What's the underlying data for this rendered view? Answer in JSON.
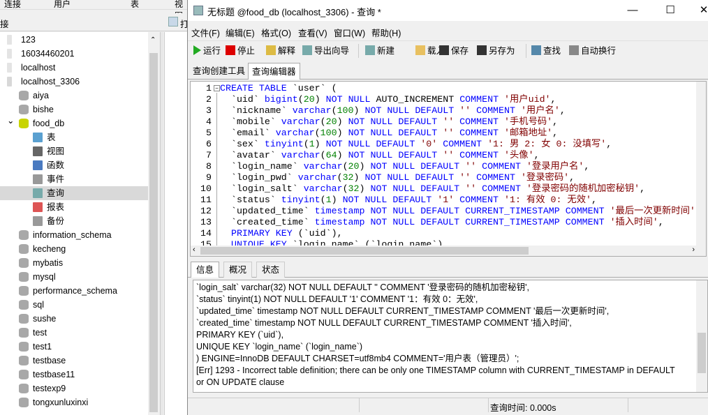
{
  "app_tabs": [
    "连接",
    "用户",
    "表",
    "视图"
  ],
  "connection_header": "接",
  "open_label": "打",
  "tree": [
    {
      "label": "123",
      "level": 0,
      "icon": "server-icon"
    },
    {
      "label": "16034460201",
      "level": 0,
      "icon": "server-icon"
    },
    {
      "label": "localhost",
      "level": 0,
      "icon": "server-icon"
    },
    {
      "label": "localhost_3306",
      "level": 0,
      "icon": "server-connected-icon"
    },
    {
      "label": "aiya",
      "level": 1,
      "icon": "database-icon"
    },
    {
      "label": "bishe",
      "level": 1,
      "icon": "database-icon"
    },
    {
      "label": "food_db",
      "level": 1,
      "icon": "database-open-icon",
      "expanded": true
    },
    {
      "label": "表",
      "level": 2,
      "icon": "table-icon"
    },
    {
      "label": "视图",
      "level": 2,
      "icon": "view-icon"
    },
    {
      "label": "函数",
      "level": 2,
      "icon": "function-icon"
    },
    {
      "label": "事件",
      "level": 2,
      "icon": "event-icon"
    },
    {
      "label": "查询",
      "level": 2,
      "icon": "query-icon",
      "selected": true
    },
    {
      "label": "报表",
      "level": 2,
      "icon": "report-icon"
    },
    {
      "label": "备份",
      "level": 2,
      "icon": "backup-icon"
    },
    {
      "label": "information_schema",
      "level": 1,
      "icon": "database-icon"
    },
    {
      "label": "kecheng",
      "level": 1,
      "icon": "database-icon"
    },
    {
      "label": "mybatis",
      "level": 1,
      "icon": "database-icon"
    },
    {
      "label": "mysql",
      "level": 1,
      "icon": "database-icon"
    },
    {
      "label": "performance_schema",
      "level": 1,
      "icon": "database-icon"
    },
    {
      "label": "sql",
      "level": 1,
      "icon": "database-icon"
    },
    {
      "label": "sushe",
      "level": 1,
      "icon": "database-icon"
    },
    {
      "label": "test",
      "level": 1,
      "icon": "database-icon"
    },
    {
      "label": "test1",
      "level": 1,
      "icon": "database-icon"
    },
    {
      "label": "testbase",
      "level": 1,
      "icon": "database-icon"
    },
    {
      "label": "testbase11",
      "level": 1,
      "icon": "database-icon"
    },
    {
      "label": "testexp9",
      "level": 1,
      "icon": "database-icon"
    },
    {
      "label": "tongxunluxinxi",
      "level": 1,
      "icon": "database-icon"
    }
  ],
  "window": {
    "title": "无标题 @food_db (localhost_3306) - 查询 *",
    "controls": {
      "minimize": "—",
      "maximize": "☐",
      "close": "✕"
    }
  },
  "menu": [
    "文件(F)",
    "编辑(E)",
    "格式(O)",
    "查看(V)",
    "窗口(W)",
    "帮助(H)"
  ],
  "toolbar": [
    {
      "label": "运行",
      "icon": "run-icon"
    },
    {
      "label": "停止",
      "icon": "stop-icon"
    },
    {
      "label": "解释",
      "icon": "explain-icon"
    },
    {
      "label": "导出向导",
      "icon": "export-wizard-icon"
    },
    {
      "label": "新建",
      "icon": "new-icon"
    },
    {
      "label": "载入",
      "icon": "load-icon"
    },
    {
      "label": "保存",
      "icon": "save-icon"
    },
    {
      "label": "另存为",
      "icon": "save-as-icon"
    },
    {
      "label": "查找",
      "icon": "find-icon"
    },
    {
      "label": "自动换行",
      "icon": "word-wrap-icon"
    }
  ],
  "query_tabs": [
    "查询创建工具",
    "查询编辑器"
  ],
  "active_query_tab": 1,
  "code_lines": [
    [
      [
        "CREATE TABLE ",
        "kw"
      ],
      [
        "`user` (",
        "id"
      ]
    ],
    [
      [
        "  `uid` ",
        "id"
      ],
      [
        "bigint",
        "kw"
      ],
      [
        "(",
        "id"
      ],
      [
        "20",
        "num"
      ],
      [
        ") ",
        "id"
      ],
      [
        "NOT NULL ",
        "kw"
      ],
      [
        "AUTO_INCREMENT ",
        "id"
      ],
      [
        "COMMENT ",
        "kw"
      ],
      [
        "'用户uid'",
        "str"
      ],
      [
        ",",
        "id"
      ]
    ],
    [
      [
        "  `nickname` ",
        "id"
      ],
      [
        "varchar",
        "kw"
      ],
      [
        "(",
        "id"
      ],
      [
        "100",
        "num"
      ],
      [
        ") ",
        "id"
      ],
      [
        "NOT NULL DEFAULT ",
        "kw"
      ],
      [
        "'' ",
        "str"
      ],
      [
        "COMMENT ",
        "kw"
      ],
      [
        "'用户名'",
        "str"
      ],
      [
        ",",
        "id"
      ]
    ],
    [
      [
        "  `mobile` ",
        "id"
      ],
      [
        "varchar",
        "kw"
      ],
      [
        "(",
        "id"
      ],
      [
        "20",
        "num"
      ],
      [
        ") ",
        "id"
      ],
      [
        "NOT NULL DEFAULT ",
        "kw"
      ],
      [
        "'' ",
        "str"
      ],
      [
        "COMMENT ",
        "kw"
      ],
      [
        "'手机号码'",
        "str"
      ],
      [
        ",",
        "id"
      ]
    ],
    [
      [
        "  `email` ",
        "id"
      ],
      [
        "varchar",
        "kw"
      ],
      [
        "(",
        "id"
      ],
      [
        "100",
        "num"
      ],
      [
        ") ",
        "id"
      ],
      [
        "NOT NULL DEFAULT ",
        "kw"
      ],
      [
        "'' ",
        "str"
      ],
      [
        "COMMENT ",
        "kw"
      ],
      [
        "'邮箱地址'",
        "str"
      ],
      [
        ",",
        "id"
      ]
    ],
    [
      [
        "  `sex` ",
        "id"
      ],
      [
        "tinyint",
        "kw"
      ],
      [
        "(",
        "id"
      ],
      [
        "1",
        "num"
      ],
      [
        ") ",
        "id"
      ],
      [
        "NOT NULL DEFAULT ",
        "kw"
      ],
      [
        "'0' ",
        "str"
      ],
      [
        "COMMENT ",
        "kw"
      ],
      [
        "'1: 男 2: 女 0: 没填写'",
        "str"
      ],
      [
        ",",
        "id"
      ]
    ],
    [
      [
        "  `avatar` ",
        "id"
      ],
      [
        "varchar",
        "kw"
      ],
      [
        "(",
        "id"
      ],
      [
        "64",
        "num"
      ],
      [
        ") ",
        "id"
      ],
      [
        "NOT NULL DEFAULT ",
        "kw"
      ],
      [
        "'' ",
        "str"
      ],
      [
        "COMMENT ",
        "kw"
      ],
      [
        "'头像'",
        "str"
      ],
      [
        ",",
        "id"
      ]
    ],
    [
      [
        "  `login_name` ",
        "id"
      ],
      [
        "varchar",
        "kw"
      ],
      [
        "(",
        "id"
      ],
      [
        "20",
        "num"
      ],
      [
        ") ",
        "id"
      ],
      [
        "NOT NULL DEFAULT ",
        "kw"
      ],
      [
        "'' ",
        "str"
      ],
      [
        "COMMENT ",
        "kw"
      ],
      [
        "'登录用户名'",
        "str"
      ],
      [
        ",",
        "id"
      ]
    ],
    [
      [
        "  `login_pwd` ",
        "id"
      ],
      [
        "varchar",
        "kw"
      ],
      [
        "(",
        "id"
      ],
      [
        "32",
        "num"
      ],
      [
        ") ",
        "id"
      ],
      [
        "NOT NULL DEFAULT ",
        "kw"
      ],
      [
        "'' ",
        "str"
      ],
      [
        "COMMENT ",
        "kw"
      ],
      [
        "'登录密码'",
        "str"
      ],
      [
        ",",
        "id"
      ]
    ],
    [
      [
        "  `login_salt` ",
        "id"
      ],
      [
        "varchar",
        "kw"
      ],
      [
        "(",
        "id"
      ],
      [
        "32",
        "num"
      ],
      [
        ") ",
        "id"
      ],
      [
        "NOT NULL DEFAULT ",
        "kw"
      ],
      [
        "'' ",
        "str"
      ],
      [
        "COMMENT ",
        "kw"
      ],
      [
        "'登录密码的随机加密秘钥'",
        "str"
      ],
      [
        ",",
        "id"
      ]
    ],
    [
      [
        "  `status` ",
        "id"
      ],
      [
        "tinyint",
        "kw"
      ],
      [
        "(",
        "id"
      ],
      [
        "1",
        "num"
      ],
      [
        ") ",
        "id"
      ],
      [
        "NOT NULL DEFAULT ",
        "kw"
      ],
      [
        "'1' ",
        "str"
      ],
      [
        "COMMENT ",
        "kw"
      ],
      [
        "'1: 有效 0: 无效'",
        "str"
      ],
      [
        ",",
        "id"
      ]
    ],
    [
      [
        "  `updated_time` ",
        "id"
      ],
      [
        "timestamp ",
        "kw"
      ],
      [
        "NOT NULL DEFAULT CURRENT_TIMESTAMP COMMENT ",
        "kw"
      ],
      [
        "'最后一次更新时间'",
        "str"
      ],
      [
        ",",
        "id"
      ]
    ],
    [
      [
        "  `created_time` ",
        "id"
      ],
      [
        "timestamp ",
        "kw"
      ],
      [
        "NOT NULL DEFAULT CURRENT_TIMESTAMP COMMENT ",
        "kw"
      ],
      [
        "'插入时间'",
        "str"
      ],
      [
        ",",
        "id"
      ]
    ],
    [
      [
        "  PRIMARY KEY ",
        "kw"
      ],
      [
        "(`uid`),",
        "id"
      ]
    ],
    [
      [
        "  UNIQUE KEY ",
        "kw"
      ],
      [
        "`login_name` (`login_name`)",
        "id"
      ]
    ]
  ],
  "info_tabs": [
    "信息",
    "概况",
    "状态"
  ],
  "info_lines": [
    "  `login_salt` varchar(32) NOT NULL DEFAULT '' COMMENT '登录密码的随机加密秘钥',",
    "  `status` tinyint(1) NOT NULL DEFAULT '1' COMMENT '1：有效 0：无效',",
    "  `updated_time` timestamp NOT NULL DEFAULT CURRENT_TIMESTAMP COMMENT '最后一次更新时间',",
    "  `created_time` timestamp NOT NULL DEFAULT CURRENT_TIMESTAMP COMMENT '插入时间',",
    "  PRIMARY KEY (`uid`),",
    "  UNIQUE KEY `login_name` (`login_name`)",
    ") ENGINE=InnoDB DEFAULT CHARSET=utf8mb4 COMMENT='用户表（管理员）';",
    "[Err] 1293 - Incorrect table definition; there can be only one TIMESTAMP column with CURRENT_TIMESTAMP in DEFAULT",
    "or ON UPDATE clause"
  ],
  "status": {
    "query_time": "查询时间: 0.000s"
  },
  "colors": {
    "keyword": "#0000ff",
    "number": "#008000",
    "string": "#800000",
    "selection": "#d9d9d9"
  }
}
